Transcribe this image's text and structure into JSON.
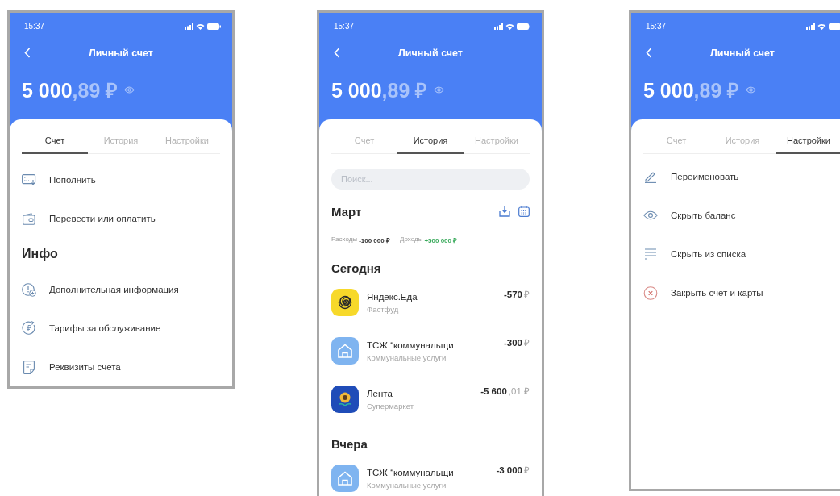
{
  "phones": [
    {
      "status_time": "15:37",
      "title": "Личный счет",
      "balance": {
        "whole": "5 000",
        "fraction": ",89 ₽"
      },
      "tabs": [
        {
          "label": "Счет",
          "selected": true
        },
        {
          "label": "История",
          "selected": false
        },
        {
          "label": "Настройки",
          "selected": false
        }
      ],
      "screen": {
        "kind": "account",
        "sections": [
          {
            "items": [
              "Пополнить",
              "Перевести или оплатить"
            ]
          },
          {
            "title": "Инфо",
            "items": [
              "Дополнительная информация",
              "Тарифы за обслуживание",
              "Реквизиты счета"
            ]
          }
        ]
      }
    },
    {
      "status_time": "15:37",
      "title": "Личный счет",
      "balance": {
        "whole": "5 000",
        "fraction": ",89 ₽"
      },
      "tabs": [
        {
          "label": "Счет",
          "selected": false
        },
        {
          "label": "История",
          "selected": true
        },
        {
          "label": "Настройки",
          "selected": false
        }
      ],
      "screen": {
        "kind": "history",
        "search": {
          "placeholder": "Поиск..."
        },
        "month": "Март",
        "summary": [
          {
            "kind": "expense",
            "label": "Расходы",
            "value": "-100 000 ₽"
          },
          {
            "kind": "income",
            "label": "Доходы",
            "value": "+500 000 ₽"
          }
        ],
        "days": [
          {
            "title": "Сегодня",
            "transactions": [
              {
                "kind": "food",
                "name": "Яндекс.Еда",
                "category": "Фастфуд",
                "amount": "-570",
                "amount_tail": "₽"
              },
              {
                "kind": "utilities",
                "name": "ТСЖ “коммунальщи",
                "category": "Коммунальные услуги",
                "amount": "-300",
                "amount_tail": "₽"
              },
              {
                "kind": "grocery",
                "name": "Лента",
                "category": "Супермаркет",
                "amount": "-5 600",
                "amount_tail": ",01 ₽"
              }
            ]
          },
          {
            "title": "Вчера",
            "transactions": [
              {
                "kind": "utilities",
                "name": "ТСЖ “коммунальщи",
                "category": "Коммунальные услуги",
                "amount": "-3 000",
                "amount_tail": "₽"
              }
            ]
          }
        ]
      }
    },
    {
      "status_time": "15:37",
      "title": "Личный счет",
      "balance": {
        "whole": "5 000",
        "fraction": ",89 ₽"
      },
      "tabs": [
        {
          "label": "Счет",
          "selected": false
        },
        {
          "label": "История",
          "selected": false
        },
        {
          "label": "Настройки",
          "selected": true
        }
      ],
      "screen": {
        "kind": "settings",
        "items": [
          "Переименовать",
          "Скрыть баланс",
          "Скрыть из списка",
          "Закрыть счет и карты"
        ]
      }
    }
  ]
}
